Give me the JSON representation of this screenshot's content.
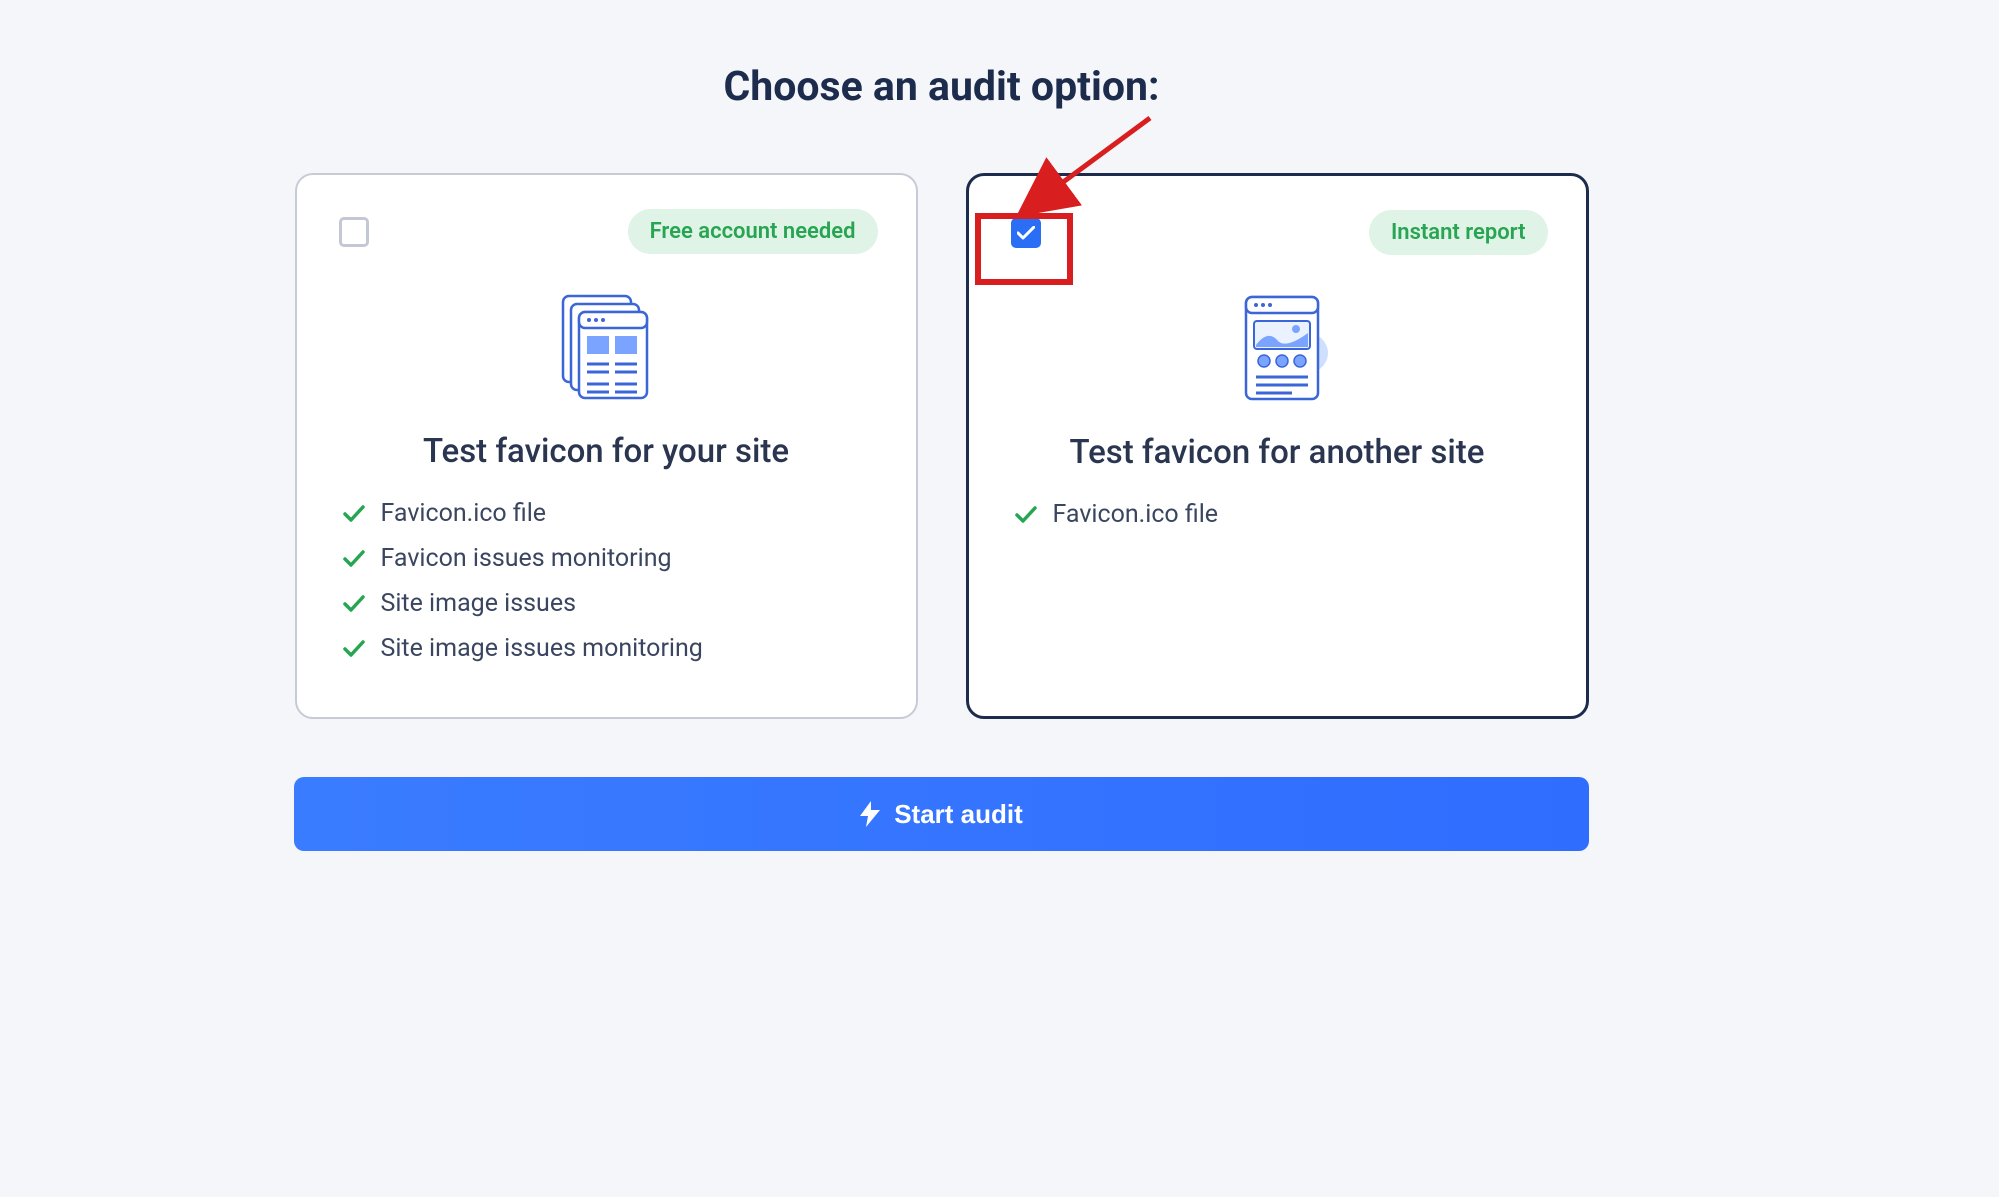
{
  "heading": "Choose an audit option:",
  "cards": [
    {
      "selected": false,
      "badge": "Free account needed",
      "title": "Test favicon for your site",
      "features": [
        "Favicon.ico file",
        "Favicon issues monitoring",
        "Site image issues",
        "Site image issues monitoring"
      ]
    },
    {
      "selected": true,
      "badge": "Instant report",
      "title": "Test favicon for another site",
      "features": [
        "Favicon.ico file"
      ]
    }
  ],
  "cta": "Start audit",
  "annotation": {
    "highlight_box": true,
    "arrow": true
  }
}
